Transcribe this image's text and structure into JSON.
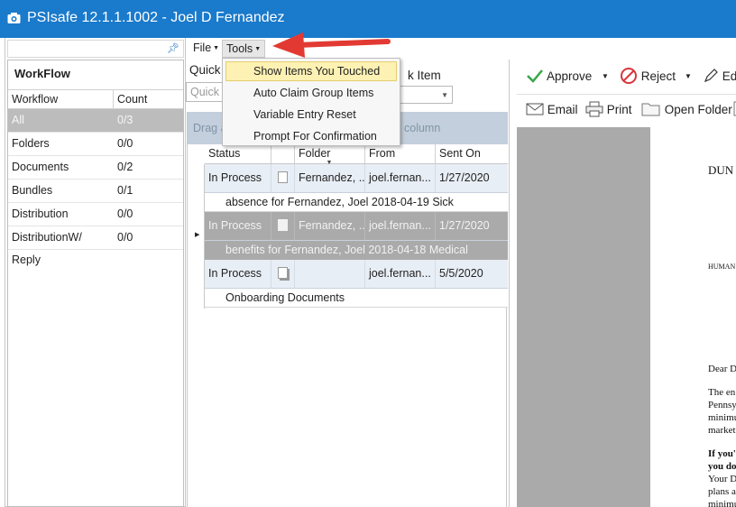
{
  "window": {
    "title": "PSIsafe 12.1.1.1002 - Joel D Fernandez"
  },
  "left_panel": {
    "header": "WorkFlow",
    "columns": {
      "workflow": "Workflow",
      "count": "Count"
    },
    "items": [
      {
        "label": "All",
        "count": "0/3",
        "selected": true
      },
      {
        "label": "Folders",
        "count": "0/0"
      },
      {
        "label": "Documents",
        "count": "0/2"
      },
      {
        "label": "Bundles",
        "count": "0/1"
      },
      {
        "label": "Distribution",
        "count": "0/0"
      },
      {
        "label": "DistributionW/ Reply",
        "count": "0/0"
      }
    ]
  },
  "menubar": {
    "file": "File",
    "tools": "Tools"
  },
  "tools_menu": {
    "items": [
      "Show Items You Touched",
      "Auto Claim Group Items",
      "Variable Entry Reset",
      "Prompt For Confirmation"
    ],
    "highlighted_index": 0
  },
  "search": {
    "quick_label": "Quick",
    "quick_placeholder": "Quick S",
    "right_label": "k Item"
  },
  "grid": {
    "group_hint_left": "Drag a",
    "group_hint_right": "column",
    "columns": {
      "status": "Status",
      "folder": "Folder",
      "from": "From",
      "sent_on": "Sent On"
    },
    "rows": [
      {
        "status": "In Process",
        "folder": "Fernandez, ...",
        "from": "joel.fernan...",
        "sent_on": "1/27/2020",
        "subject": "absence for Fernandez, Joel 2018-04-19 Sick"
      },
      {
        "status": "In Process",
        "folder": "Fernandez, ...",
        "from": "joel.fernan...",
        "sent_on": "1/27/2020",
        "subject": "benefits for Fernandez, Joel 2018-04-18 Medical"
      },
      {
        "status": "In Process",
        "folder": "",
        "from": "joel.fernan...",
        "sent_on": "5/5/2020",
        "subject": "Onboarding Documents"
      }
    ]
  },
  "right_panel": {
    "toolbar1": {
      "approve": "Approve",
      "reject": "Reject",
      "edit": "Ed"
    },
    "toolbar2": {
      "email": "Email",
      "print": "Print",
      "open_folder": "Open Folder"
    },
    "preview_fragments": [
      "DUN",
      "HUMAN",
      "Dear D",
      "The en",
      "Pennsy",
      "minimu",
      "market",
      "If you'",
      "you do",
      "Your D",
      "plans a",
      "minimu"
    ]
  },
  "colors": {
    "titlebar": "#1a7acb",
    "annotation_arrow": "#e23a33",
    "menu_highlight": "#fdf1b3"
  }
}
